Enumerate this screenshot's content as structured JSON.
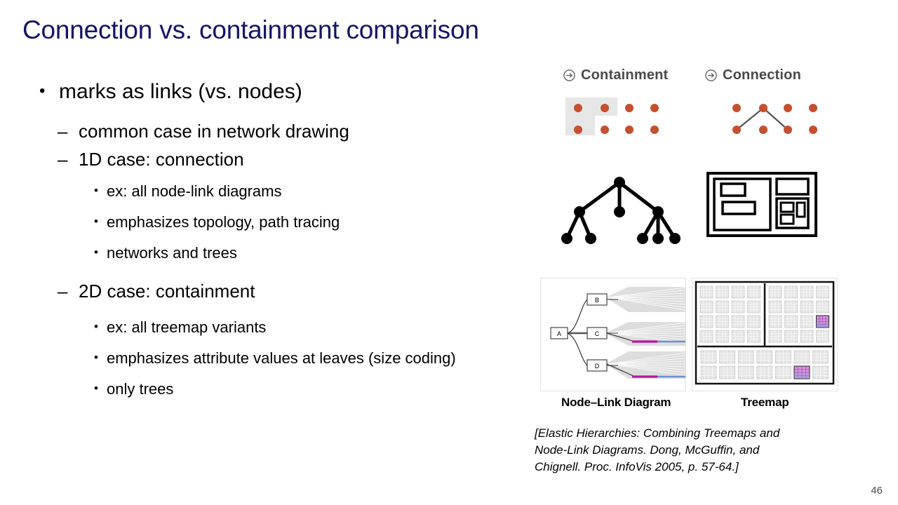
{
  "slide": {
    "title": "Connection vs. containment comparison",
    "page_number": "46"
  },
  "outline": {
    "bullet_glyphs": {
      "level1": "•",
      "level2": "–",
      "level3": "•"
    },
    "items": [
      {
        "level": 1,
        "text": "marks as links (vs. nodes)"
      },
      {
        "level": 2,
        "text": "common case in network drawing"
      },
      {
        "level": 2,
        "text": "1D case: connection"
      },
      {
        "level": 3,
        "text": "ex: all node-link diagrams"
      },
      {
        "level": 3,
        "text": "emphasizes topology, path tracing"
      },
      {
        "level": 3,
        "text": "networks and trees"
      },
      {
        "level": 2,
        "text": "2D case: containment"
      },
      {
        "level": 3,
        "text": "ex: all treemap variants"
      },
      {
        "level": 3,
        "text": "emphasizes attribute values at leaves (size coding)"
      },
      {
        "level": 3,
        "text": "only trees"
      }
    ]
  },
  "figures": {
    "marks": {
      "containment": {
        "label": "Containment",
        "icon": "circle-arrow-icon"
      },
      "connection": {
        "label": "Connection",
        "icon": "circle-arrow-icon"
      },
      "dot_color": "#c4502f",
      "region_fill": "#e6e6e6",
      "link_color": "#4d4d4d",
      "grid": {
        "columns": 4,
        "rows": 2
      }
    },
    "abstract": {
      "tree": {
        "name": "node-link-tree",
        "node_color": "#000000"
      },
      "nested": {
        "name": "nested-boxes",
        "stroke_color": "#000000"
      }
    },
    "elastic": {
      "nodelink": {
        "caption": "Node–Link Diagram",
        "nodes": [
          "A",
          "B",
          "C",
          "D"
        ],
        "highlight_colors": [
          "#b5179e",
          "#6b8fd4"
        ]
      },
      "treemap": {
        "caption": "Treemap",
        "cell_color": "#cfcfcf",
        "highlight_colors": [
          "#d47ad4",
          "#7aa8e0"
        ]
      }
    }
  },
  "citation": {
    "line1": "[Elastic Hierarchies: Combining Treemaps and",
    "line2": "Node-Link Diagrams. Dong, McGuffin, and",
    "line3": "Chignell. Proc. InfoVis 2005, p. 57-64.]"
  }
}
